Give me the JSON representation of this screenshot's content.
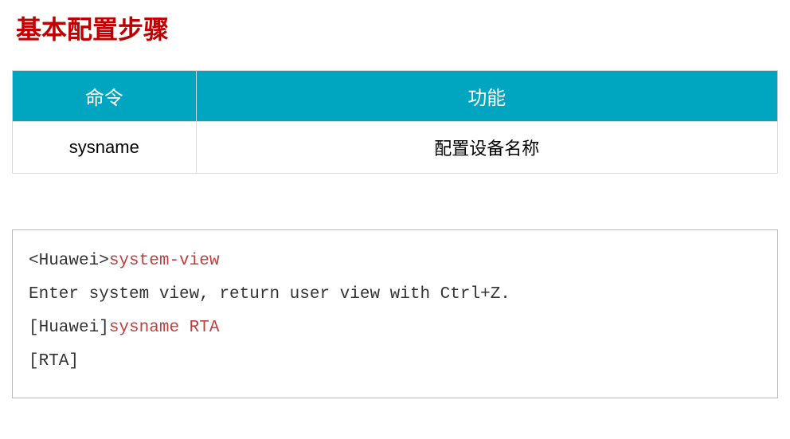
{
  "title": "基本配置步骤",
  "table": {
    "headers": {
      "command": "命令",
      "function": "功能"
    },
    "rows": [
      {
        "command": "sysname",
        "function": "配置设备名称"
      }
    ]
  },
  "terminal": {
    "lines": [
      {
        "prompt": "<Huawei>",
        "cmd": "system-view"
      },
      {
        "text": "Enter system view, return user view with Ctrl+Z."
      },
      {
        "prompt": "[Huawei]",
        "cmd": "sysname RTA"
      },
      {
        "prompt": "[RTA]",
        "cmd": ""
      }
    ]
  }
}
